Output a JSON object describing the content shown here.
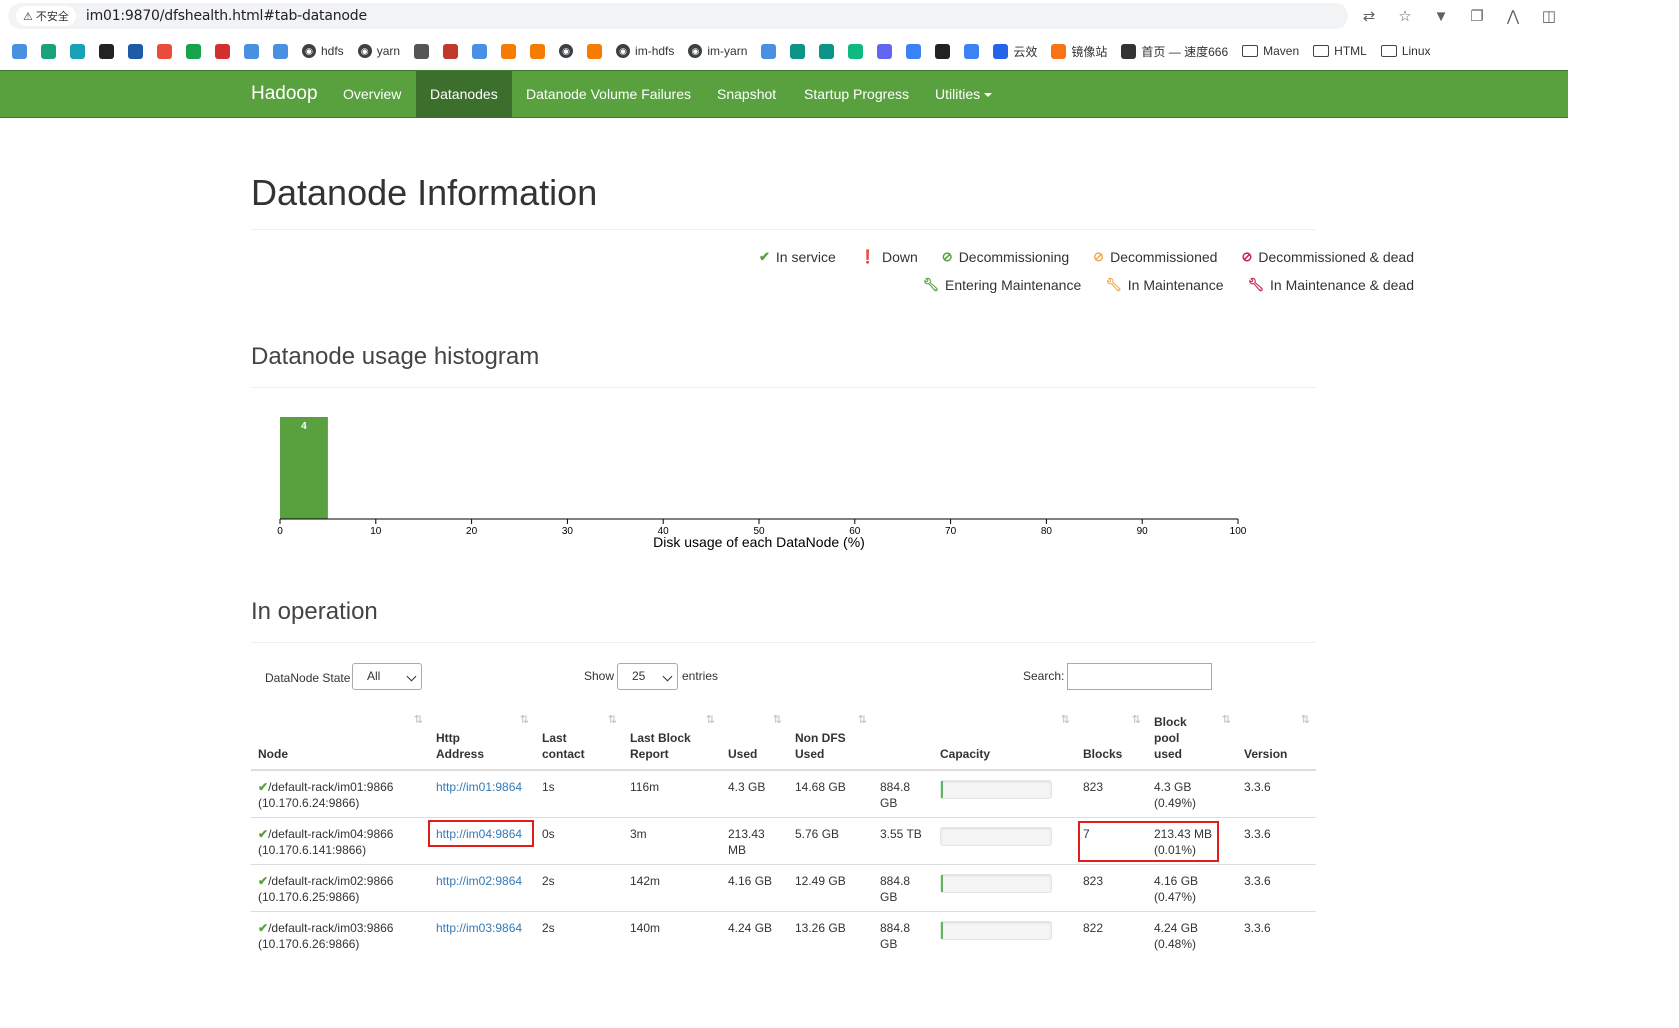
{
  "browser": {
    "insecure_label": "不安全",
    "url": "im01:9870/dfshealth.html#tab-datanode",
    "bookmarks": [
      {
        "label": "",
        "icon": "bookmark-icon-1",
        "color": "#4a90e2"
      },
      {
        "label": "",
        "icon": "bookmark-icon-2",
        "color": "#1aa37a"
      },
      {
        "label": "",
        "icon": "bookmark-icon-3",
        "color": "#17a2b8"
      },
      {
        "label": "",
        "icon": "bookmark-icon-4",
        "color": "#222"
      },
      {
        "label": "",
        "icon": "mvn-icon",
        "color": "#1e5aa8"
      },
      {
        "label": "",
        "icon": "bookmark-icon-6",
        "color": "#e94b3c"
      },
      {
        "label": "",
        "icon": "bookmark-icon-7",
        "color": "#16a34a"
      },
      {
        "label": "",
        "icon": "bookmark-icon-8",
        "color": "#d32f2f"
      },
      {
        "label": "",
        "icon": "bookmark-icon-9",
        "color": "#4a90e2"
      },
      {
        "label": "",
        "icon": "bookmark-icon-10",
        "color": "#4a90e2"
      },
      {
        "label": "hdfs",
        "icon": "globe-icon"
      },
      {
        "label": "yarn",
        "icon": "globe-icon"
      },
      {
        "label": "",
        "icon": "bookmark-icon-13",
        "color": "#555"
      },
      {
        "label": "",
        "icon": "bookmark-icon-14",
        "color": "#c0392b"
      },
      {
        "label": "",
        "icon": "bookmark-icon-15",
        "color": "#4a90e2"
      },
      {
        "label": "",
        "icon": "bookmark-icon-16",
        "color": "#f57c00"
      },
      {
        "label": "",
        "icon": "bookmark-icon-17",
        "color": "#f57c00"
      },
      {
        "label": "",
        "icon": "globe-icon"
      },
      {
        "label": "",
        "icon": "bookmark-icon-19",
        "color": "#f57c00"
      },
      {
        "label": "im-hdfs",
        "icon": "globe-icon"
      },
      {
        "label": "im-yarn",
        "icon": "globe-icon"
      },
      {
        "label": "",
        "icon": "bookmark-icon-22",
        "color": "#4a90e2"
      },
      {
        "label": "",
        "icon": "bookmark-icon-23",
        "color": "#0d9488"
      },
      {
        "label": "",
        "icon": "bookmark-icon-24",
        "color": "#0d9488"
      },
      {
        "label": "",
        "icon": "bookmark-icon-25",
        "color": "#10b981"
      },
      {
        "label": "",
        "icon": "bookmark-icon-26",
        "color": "#6366f1"
      },
      {
        "label": "",
        "icon": "bookmark-icon-27",
        "color": "#3b82f6"
      },
      {
        "label": "",
        "icon": "bookmark-icon-28",
        "color": "#222"
      },
      {
        "label": "",
        "icon": "bookmark-icon-29",
        "color": "#3b82f6"
      },
      {
        "label": "云效",
        "icon": "bookmark-icon-30",
        "color": "#2563eb"
      },
      {
        "label": "镜像站",
        "icon": "bookmark-icon-31",
        "color": "#f97316"
      },
      {
        "label": "首页 — 速度666",
        "icon": "bookmark-icon-32",
        "color": "#333"
      },
      {
        "label": "Maven",
        "icon": "folder-icon"
      },
      {
        "label": "HTML",
        "icon": "folder-icon"
      },
      {
        "label": "Linux",
        "icon": "folder-icon"
      }
    ]
  },
  "navbar": {
    "brand": "Hadoop",
    "items": [
      "Overview",
      "Datanodes",
      "Datanode Volume Failures",
      "Snapshot",
      "Startup Progress",
      "Utilities"
    ],
    "active": "Datanodes",
    "color": "#59a13e"
  },
  "page": {
    "title": "Datanode Information"
  },
  "legend": [
    {
      "label": "In service",
      "symbol": "check-icon",
      "color": "#59a13e"
    },
    {
      "label": "Down",
      "symbol": "exclamation-circle-icon",
      "color": "#c7254e"
    },
    {
      "label": "Decommissioning",
      "symbol": "ban-icon",
      "color": "#59a13e"
    },
    {
      "label": "Decommissioned",
      "symbol": "ban-icon",
      "color": "#f0ad4e"
    },
    {
      "label": "Decommissioned & dead",
      "symbol": "ban-icon",
      "color": "#c7254e"
    },
    {
      "label": "Entering Maintenance",
      "symbol": "wrench-icon",
      "color": "#59a13e"
    },
    {
      "label": "In Maintenance",
      "symbol": "wrench-icon",
      "color": "#f0ad4e"
    },
    {
      "label": "In Maintenance & dead",
      "symbol": "wrench-icon",
      "color": "#c7254e"
    }
  ],
  "histogram": {
    "title": "Datanode usage histogram"
  },
  "chart_data": {
    "type": "bar",
    "bins": [
      [
        0,
        5
      ]
    ],
    "counts": [
      4
    ],
    "xlabel": "Disk usage of each DataNode (%)",
    "xlim": [
      0,
      100
    ],
    "xticks": [
      0,
      10,
      20,
      30,
      40,
      50,
      60,
      70,
      80,
      90,
      100
    ],
    "bar_color": "#59a13e"
  },
  "operation": {
    "title": "In operation",
    "state_label": "DataNode State",
    "state_value": "All",
    "show_label": "Show",
    "entries_value": "25",
    "entries_label": "entries",
    "search_label": "Search:",
    "search_value": "",
    "columns": [
      "Node",
      "Http Address",
      "Last contact",
      "Last Block Report",
      "Used",
      "Non DFS Used",
      "",
      "Capacity",
      "Blocks",
      "Block pool used",
      "Version"
    ],
    "rows": [
      {
        "node": "/default-rack/im01:9866",
        "ip": "(10.170.6.24:9866)",
        "http": "http://im01:9864",
        "last_contact": "1s",
        "last_block": "116m",
        "used": "4.3 GB",
        "non_dfs": "14.68 GB",
        "capacity": "884.8 GB",
        "cap_pct": 1,
        "blocks": "823",
        "bp_used": "4.3 GB",
        "bp_pct": "(0.49%)",
        "version": "3.3.6"
      },
      {
        "node": "/default-rack/im04:9866",
        "ip": "(10.170.6.141:9866)",
        "http": "http://im04:9864",
        "last_contact": "0s",
        "last_block": "3m",
        "used": "213.43 MB",
        "non_dfs": "5.76 GB",
        "capacity": "3.55 TB",
        "cap_pct": 0,
        "blocks": "7",
        "bp_used": "213.43 MB",
        "bp_pct": "(0.01%)",
        "version": "3.3.6"
      },
      {
        "node": "/default-rack/im02:9866",
        "ip": "(10.170.6.25:9866)",
        "http": "http://im02:9864",
        "last_contact": "2s",
        "last_block": "142m",
        "used": "4.16 GB",
        "non_dfs": "12.49 GB",
        "capacity": "884.8 GB",
        "cap_pct": 1,
        "blocks": "823",
        "bp_used": "4.16 GB",
        "bp_pct": "(0.47%)",
        "version": "3.3.6"
      },
      {
        "node": "/default-rack/im03:9866",
        "ip": "(10.170.6.26:9866)",
        "http": "http://im03:9864",
        "last_contact": "2s",
        "last_block": "140m",
        "used": "4.24 GB",
        "non_dfs": "13.26 GB",
        "capacity": "884.8 GB",
        "cap_pct": 1,
        "blocks": "822",
        "bp_used": "4.24 GB",
        "bp_pct": "(0.48%)",
        "version": "3.3.6"
      }
    ]
  }
}
